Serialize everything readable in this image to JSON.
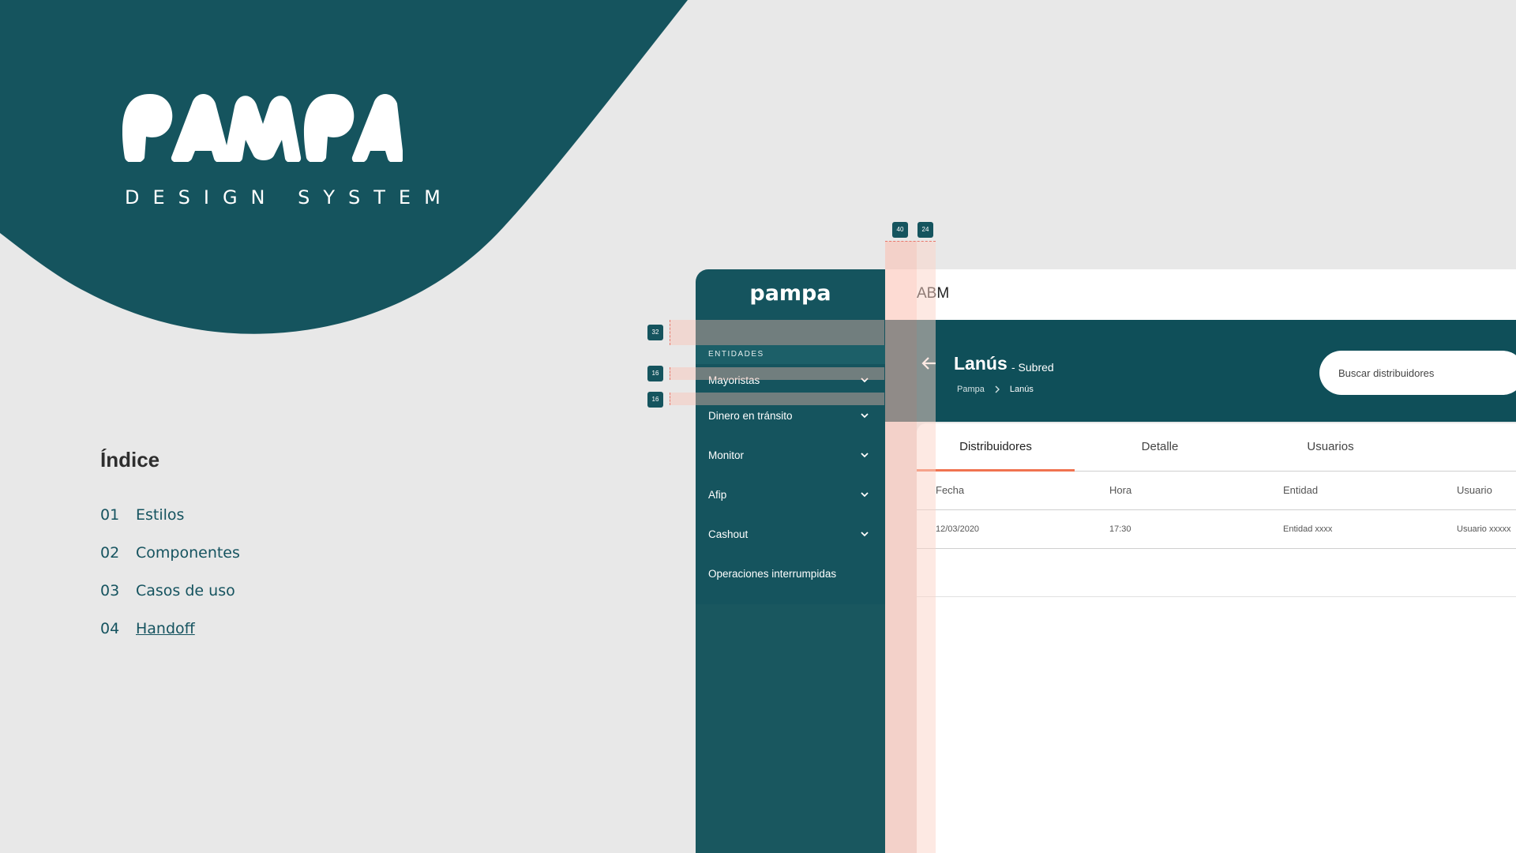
{
  "hero": {
    "brand": "PAMPA",
    "tagline": "DESIGN SYSTEM"
  },
  "index": {
    "title": "Índice",
    "items": [
      {
        "num": "01",
        "label": "Estilos"
      },
      {
        "num": "02",
        "label": "Componentes"
      },
      {
        "num": "03",
        "label": "Casos de uso"
      },
      {
        "num": "04",
        "label": "Handoff"
      }
    ]
  },
  "app": {
    "logo": "pampa",
    "sidebar": {
      "section": "ENTIDADES",
      "items": [
        {
          "label": "Mayoristas"
        },
        {
          "label": "Dinero en tránsito"
        },
        {
          "label": "Monitor"
        },
        {
          "label": "Afip"
        },
        {
          "label": "Cashout"
        },
        {
          "label": "Operaciones interrumpidas"
        }
      ]
    },
    "topbar": {
      "title": "ABM"
    },
    "header": {
      "title": "Lanús",
      "subtitle": "- Subred",
      "breadcrumb": [
        "Pampa",
        "Lanús"
      ],
      "search_placeholder": "Buscar distribuidores"
    },
    "tabs": [
      "Distribuidores",
      "Detalle",
      "Usuarios"
    ],
    "table": {
      "columns": [
        "Fecha",
        "Hora",
        "Entidad",
        "Usuario"
      ],
      "rows": [
        [
          "12/03/2020",
          "17:30",
          "Entidad xxxx",
          "Usuario xxxxx"
        ]
      ]
    }
  },
  "redlines": {
    "spacing_labels": [
      "40",
      "24",
      "32",
      "16",
      "16"
    ]
  },
  "colors": {
    "primary": "#15545e",
    "background": "#e8e8e8",
    "accent": "#f07350",
    "redline": "#fcc9bd"
  }
}
